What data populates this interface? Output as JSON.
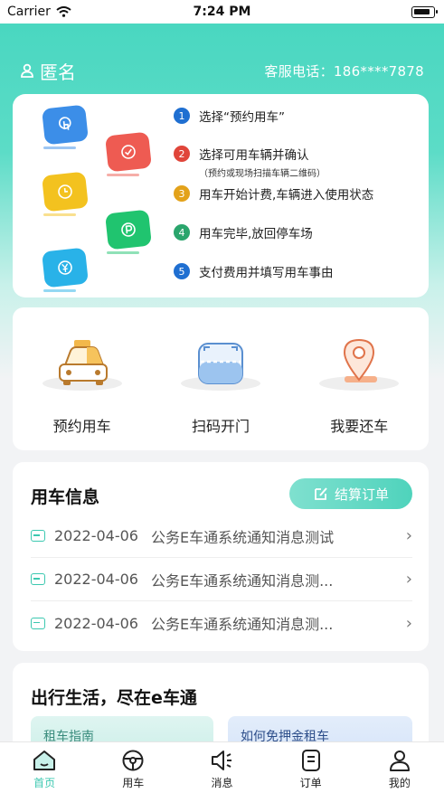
{
  "status_bar": {
    "carrier": "Carrier",
    "time": "7:24 PM"
  },
  "header": {
    "user_name": "匿名",
    "service_phone": "客服电话：186****7878"
  },
  "colors": {
    "accent": "#46d6bf",
    "step1": "#1f6fd1",
    "step2": "#e0453a",
    "step3": "#e3a21a",
    "step4": "#2aa56c",
    "step5": "#1f6fd1"
  },
  "steps": [
    {
      "num": "1",
      "text": "选择“预约用车”",
      "sub": ""
    },
    {
      "num": "2",
      "text": "选择可用车辆并确认",
      "sub": "（预约或现场扫描车辆二维码）"
    },
    {
      "num": "3",
      "text": "用车开始计费,车辆进入使用状态",
      "sub": ""
    },
    {
      "num": "4",
      "text": "用车完毕,放回停车场",
      "sub": ""
    },
    {
      "num": "5",
      "text": "支付费用并填写用车事由",
      "sub": ""
    }
  ],
  "actions": [
    {
      "label": "预约用车",
      "icon": "taxi-icon"
    },
    {
      "label": "扫码开门",
      "icon": "scan-icon"
    },
    {
      "label": "我要还车",
      "icon": "location-pin-icon"
    }
  ],
  "info": {
    "title": "用车信息",
    "settle_button": "结算订单",
    "messages": [
      {
        "date": "2022-04-06",
        "text": "公务E车通系统通知消息测试"
      },
      {
        "date": "2022-04-06",
        "text": "公务E车通系统通知消息测..."
      },
      {
        "date": "2022-04-06",
        "text": "公务E车通系统通知消息测..."
      }
    ]
  },
  "life": {
    "title": "出行生活，尽在e车通",
    "left_card": "租车指南",
    "right_card": "如何免押金租车"
  },
  "tabs": [
    {
      "label": "首页",
      "icon": "home-icon",
      "active": true
    },
    {
      "label": "用车",
      "icon": "steering-wheel-icon",
      "active": false
    },
    {
      "label": "消息",
      "icon": "speaker-icon",
      "active": false
    },
    {
      "label": "订单",
      "icon": "order-icon",
      "active": false
    },
    {
      "label": "我的",
      "icon": "user-icon",
      "active": false
    }
  ]
}
